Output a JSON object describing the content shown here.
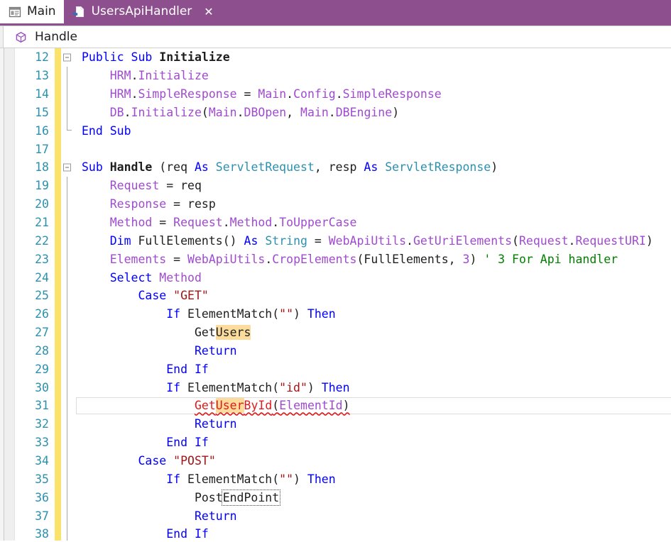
{
  "window": {
    "accent_color": "#8e4f8e",
    "background": "#ffffff"
  },
  "tabs": [
    {
      "label": "Main",
      "icon": "form-designer-icon",
      "active": false,
      "closable": false
    },
    {
      "label": "UsersApiHandler",
      "icon": "code-class-file-icon",
      "active": true,
      "closable": true,
      "close_glyph": "✕"
    }
  ],
  "navbar": {
    "icon": "method-cube-icon",
    "label": "Handle"
  },
  "editor": {
    "first_line_number": 12,
    "current_line_number": 31,
    "colors": {
      "keyword": "#0000ff",
      "type": "#2b91af",
      "member": "#a04ad0",
      "string": "#a31515",
      "number": "#a04ad0",
      "comment": "#008000",
      "error": "#e01b1b",
      "identifier": "#1e1e1e",
      "linenumber": "#2b91af",
      "change_bar": "#fbe36b",
      "search_highlight": "#fbdc9c"
    },
    "search_term": "User",
    "lines": [
      {
        "n": 12,
        "fold": "open",
        "text": "Public Sub Initialize"
      },
      {
        "n": 13,
        "fold": "line",
        "text": "    HRM.Initialize"
      },
      {
        "n": 14,
        "fold": "line",
        "text": "    HRM.SimpleResponse = Main.Config.SimpleResponse"
      },
      {
        "n": 15,
        "fold": "line",
        "text": "    DB.Initialize(Main.DBOpen, Main.DBEngine)"
      },
      {
        "n": 16,
        "fold": "end",
        "text": "End Sub"
      },
      {
        "n": 17,
        "fold": "none",
        "text": ""
      },
      {
        "n": 18,
        "fold": "open",
        "text": "Sub Handle (req As ServletRequest, resp As ServletResponse)"
      },
      {
        "n": 19,
        "fold": "line",
        "text": "    Request = req"
      },
      {
        "n": 20,
        "fold": "line",
        "text": "    Response = resp"
      },
      {
        "n": 21,
        "fold": "line",
        "text": "    Method = Request.Method.ToUpperCase"
      },
      {
        "n": 22,
        "fold": "line",
        "text": "    Dim FullElements() As String = WebApiUtils.GetUriElements(Request.RequestURI)"
      },
      {
        "n": 23,
        "fold": "line",
        "text": "    Elements = WebApiUtils.CropElements(FullElements, 3) ' 3 For Api handler"
      },
      {
        "n": 24,
        "fold": "line",
        "text": "    Select Method"
      },
      {
        "n": 25,
        "fold": "line",
        "text": "        Case \"GET\""
      },
      {
        "n": 26,
        "fold": "line",
        "text": "            If ElementMatch(\"\") Then"
      },
      {
        "n": 27,
        "fold": "line",
        "text": "                GetUsers"
      },
      {
        "n": 28,
        "fold": "line",
        "text": "                Return"
      },
      {
        "n": 29,
        "fold": "line",
        "text": "            End If"
      },
      {
        "n": 30,
        "fold": "line",
        "text": "            If ElementMatch(\"id\") Then"
      },
      {
        "n": 31,
        "fold": "line",
        "text": "                GetUserById(ElementId)"
      },
      {
        "n": 32,
        "fold": "line",
        "text": "                Return"
      },
      {
        "n": 33,
        "fold": "line",
        "text": "            End If"
      },
      {
        "n": 34,
        "fold": "line",
        "text": "        Case \"POST\""
      },
      {
        "n": 35,
        "fold": "line",
        "text": "            If ElementMatch(\"\") Then"
      },
      {
        "n": 36,
        "fold": "line",
        "text": "                PostEndPoint"
      },
      {
        "n": 37,
        "fold": "line",
        "text": "                Return"
      },
      {
        "n": 38,
        "fold": "line",
        "text": "            End If"
      }
    ]
  }
}
